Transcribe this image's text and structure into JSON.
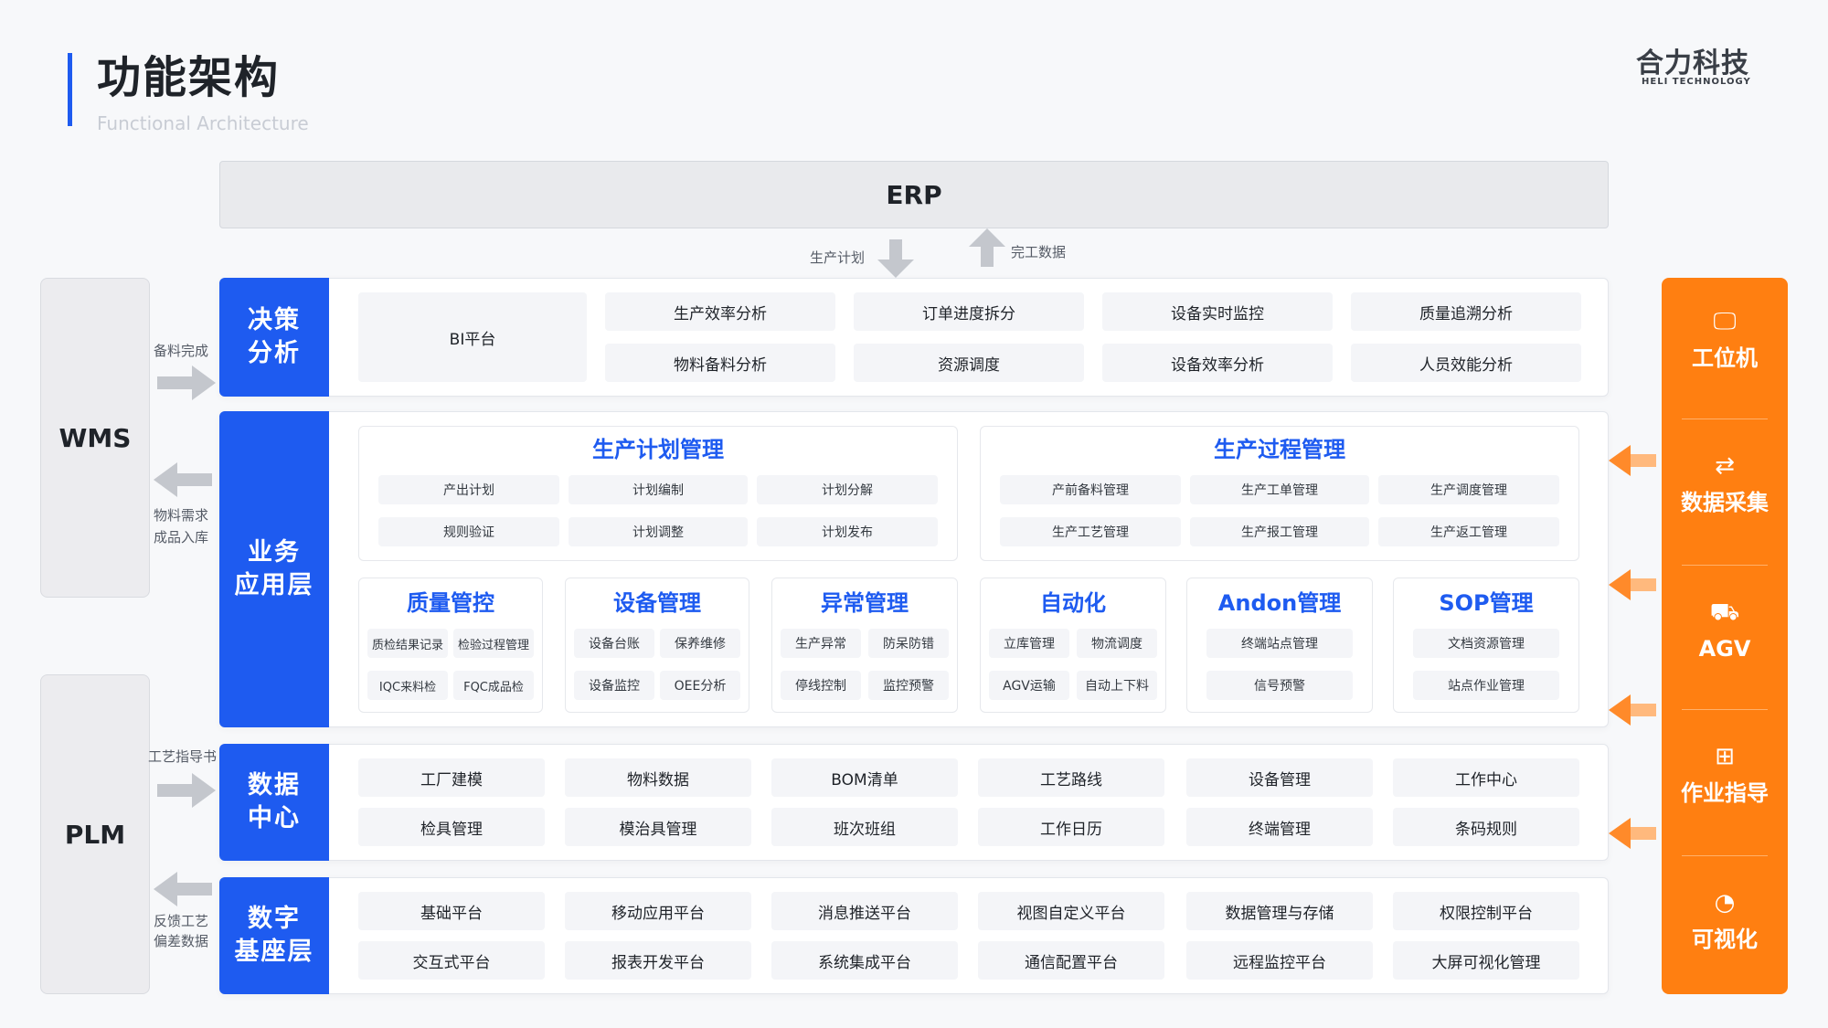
{
  "header": {
    "title": "功能架构",
    "subtitle": "Functional Architecture",
    "logo": "合力科技",
    "logo_sub": "HELI TECHNOLOGY"
  },
  "erp": {
    "label": "ERP",
    "down_label": "生产计划",
    "up_label": "完工数据"
  },
  "left": {
    "wms": "WMS",
    "plm": "PLM",
    "tag_beiliao": "备料完成",
    "tag_wuliao_1": "物料需求",
    "tag_wuliao_2": "成品入库",
    "tag_gongyi": "工艺指导书",
    "tag_fankui_1": "反馈工艺",
    "tag_fankui_2": "偏差数据"
  },
  "decision": {
    "label": "决策\n分析",
    "bi": "BI平台",
    "items": [
      "生产效率分析",
      "订单进度拆分",
      "设备实时监控",
      "质量追溯分析",
      "物料备料分析",
      "资源调度",
      "设备效率分析",
      "人员效能分析"
    ]
  },
  "business": {
    "label": "业务\n应用层",
    "plan": {
      "title": "生产计划管理",
      "items": [
        "产出计划",
        "计划编制",
        "计划分解",
        "规则验证",
        "计划调整",
        "计划发布"
      ]
    },
    "process": {
      "title": "生产过程管理",
      "items": [
        "产前备料管理",
        "生产工单管理",
        "生产调度管理",
        "生产工艺管理",
        "生产报工管理",
        "生产返工管理"
      ]
    },
    "modules": [
      {
        "title": "质量管控",
        "items": [
          "质检结果记录",
          "检验过程管理",
          "IQC来料检",
          "FQC成品检"
        ]
      },
      {
        "title": "设备管理",
        "items": [
          "设备台账",
          "保养维修",
          "设备监控",
          "OEE分析"
        ]
      },
      {
        "title": "异常管理",
        "items": [
          "生产异常",
          "防呆防错",
          "停线控制",
          "监控预警"
        ]
      },
      {
        "title": "自动化",
        "items": [
          "立库管理",
          "物流调度",
          "AGV运输",
          "自动上下料"
        ]
      },
      {
        "title": "Andon管理",
        "items": [
          "终端站点管理",
          "信号预警"
        ]
      },
      {
        "title": "SOP管理",
        "items": [
          "文档资源管理",
          "站点作业管理"
        ]
      }
    ]
  },
  "data_center": {
    "label": "数据\n中心",
    "items": [
      "工厂建模",
      "物料数据",
      "BOM清单",
      "工艺路线",
      "设备管理",
      "工作中心",
      "检具管理",
      "模治具管理",
      "班次班组",
      "工作日历",
      "终端管理",
      "条码规则"
    ]
  },
  "digital_base": {
    "label": "数字\n基座层",
    "items": [
      "基础平台",
      "移动应用平台",
      "消息推送平台",
      "视图自定义平台",
      "数据管理与存储",
      "权限控制平台",
      "交互式平台",
      "报表开发平台",
      "系统集成平台",
      "通信配置平台",
      "远程监控平台",
      "大屏可视化管理"
    ]
  },
  "right": {
    "items": [
      {
        "icon": "monitor-icon",
        "glyph": "🖵",
        "label": "工位机"
      },
      {
        "icon": "data-collect-icon",
        "glyph": "⇄",
        "label": "数据采集"
      },
      {
        "icon": "agv-icon",
        "glyph": "⛟",
        "label": "AGV"
      },
      {
        "icon": "grid-icon",
        "glyph": "⊞",
        "label": "作业指导"
      },
      {
        "icon": "chart-icon",
        "glyph": "◔",
        "label": "可视化"
      }
    ]
  },
  "colors": {
    "accent": "#1e5bf0",
    "orange": "#ff7f11",
    "cell_bg": "#f4f5f8"
  }
}
